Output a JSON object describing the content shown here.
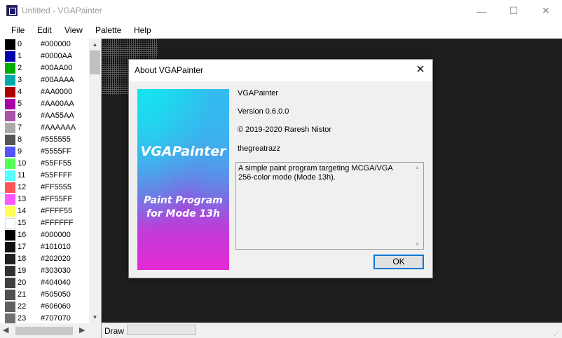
{
  "window": {
    "title": "Untitled - VGAPainter",
    "minimize": "—",
    "maximize": "☐",
    "close": "✕"
  },
  "menu": [
    "File",
    "Edit",
    "View",
    "Palette",
    "Help"
  ],
  "palette": [
    {
      "index": "0",
      "hex": "#000000",
      "color": "#000000"
    },
    {
      "index": "1",
      "hex": "#0000AA",
      "color": "#0000AA"
    },
    {
      "index": "2",
      "hex": "#00AA00",
      "color": "#00AA00"
    },
    {
      "index": "3",
      "hex": "#00AAAA",
      "color": "#00AAAA"
    },
    {
      "index": "4",
      "hex": "#AA0000",
      "color": "#AA0000"
    },
    {
      "index": "5",
      "hex": "#AA00AA",
      "color": "#AA00AA"
    },
    {
      "index": "6",
      "hex": "#AA55AA",
      "color": "#AA55AA"
    },
    {
      "index": "7",
      "hex": "#AAAAAA",
      "color": "#AAAAAA"
    },
    {
      "index": "8",
      "hex": "#555555",
      "color": "#555555"
    },
    {
      "index": "9",
      "hex": "#5555FF",
      "color": "#5555FF"
    },
    {
      "index": "10",
      "hex": "#55FF55",
      "color": "#55FF55"
    },
    {
      "index": "11",
      "hex": "#55FFFF",
      "color": "#55FFFF"
    },
    {
      "index": "12",
      "hex": "#FF5555",
      "color": "#FF5555"
    },
    {
      "index": "13",
      "hex": "#FF55FF",
      "color": "#FF55FF"
    },
    {
      "index": "14",
      "hex": "#FFFF55",
      "color": "#FFFF55"
    },
    {
      "index": "15",
      "hex": "#FFFFFF",
      "color": "#FFFFFF"
    },
    {
      "index": "16",
      "hex": "#000000",
      "color": "#000000"
    },
    {
      "index": "17",
      "hex": "#101010",
      "color": "#101010"
    },
    {
      "index": "18",
      "hex": "#202020",
      "color": "#202020"
    },
    {
      "index": "19",
      "hex": "#303030",
      "color": "#303030"
    },
    {
      "index": "20",
      "hex": "#404040",
      "color": "#404040"
    },
    {
      "index": "21",
      "hex": "#505050",
      "color": "#505050"
    },
    {
      "index": "22",
      "hex": "#606060",
      "color": "#606060"
    },
    {
      "index": "23",
      "hex": "#707070",
      "color": "#707070"
    }
  ],
  "status": {
    "tool": "Draw"
  },
  "about": {
    "title": "About VGAPainter",
    "banner_title": "VGAPainter",
    "banner_subtitle_1": "Paint Program",
    "banner_subtitle_2": "for Mode 13h",
    "product": "VGAPainter",
    "version": "Version 0.6.0.0",
    "copyright": "© 2019-2020 Raresh Nistor",
    "company": "thegreatrazz",
    "description": "A simple paint program targeting MCGA/VGA 256-color mode (Mode 13h).",
    "ok_label": "OK"
  },
  "icons": {
    "close": "close-icon",
    "maximize": "maximize-icon",
    "minimize": "minimize-icon",
    "app": "app-icon",
    "scroll_up": "scroll-up-icon",
    "scroll_down": "scroll-down-icon",
    "scroll_left": "scroll-left-icon",
    "scroll_right": "scroll-right-icon",
    "grip": "size-grip-icon"
  }
}
